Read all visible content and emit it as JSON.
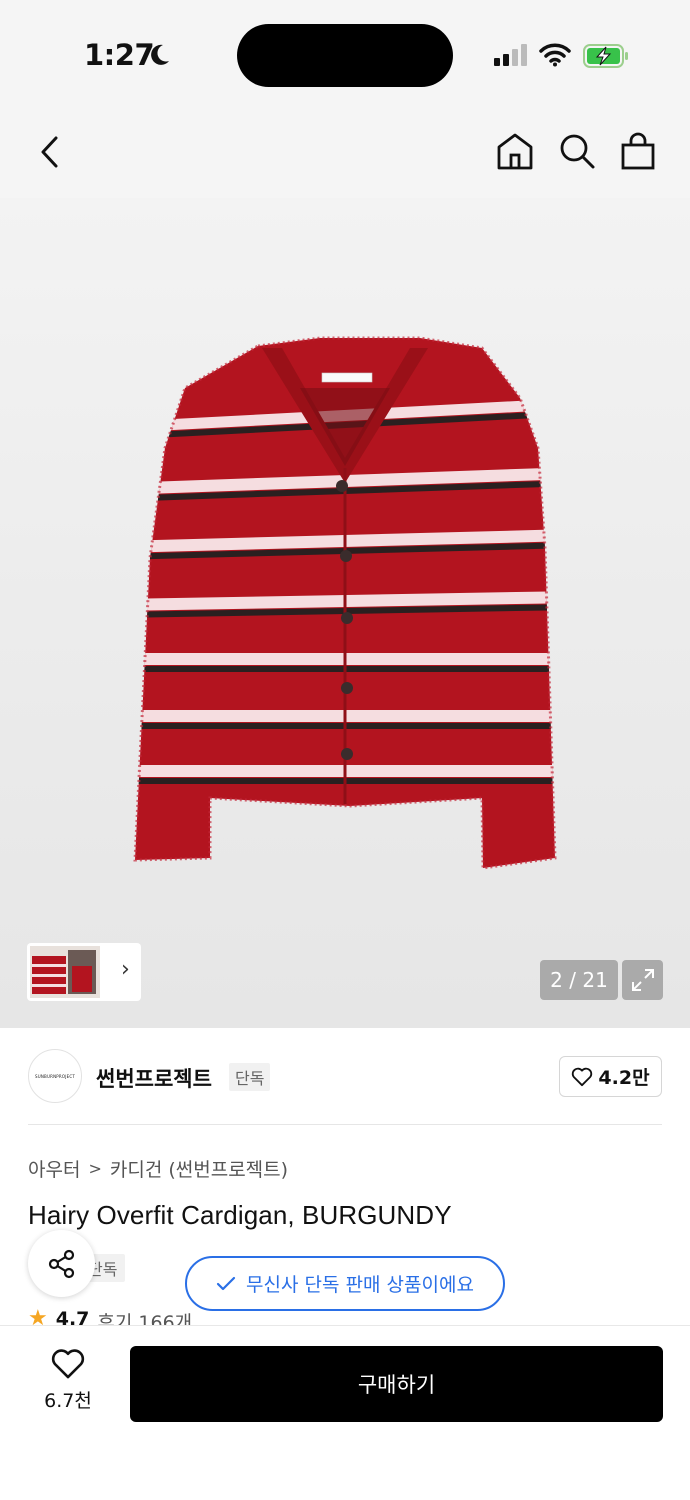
{
  "status_bar": {
    "time": "1:27",
    "icons": [
      "moon-icon",
      "cellular-signal-icon",
      "wifi-icon",
      "battery-charging-icon"
    ]
  },
  "nav": {
    "icons": [
      "back-chevron-icon",
      "home-icon",
      "search-icon",
      "shopping-bag-icon"
    ]
  },
  "gallery": {
    "counter": "2 / 21",
    "thumbnail_arrow": "›",
    "icons": [
      "expand-icon"
    ]
  },
  "brand": {
    "logo_text": "SUNBURNPROJECT",
    "name": "썬번프로젝트",
    "tag": "단독",
    "likes": "4.2만"
  },
  "breadcrumb": {
    "category": "아우터",
    "separator": ">",
    "subcategory": "카디건 (썬번프로젝트)"
  },
  "product": {
    "title": "Hairy Overfit Cardigan, BURGUNDY",
    "exclusive_tag": "단독"
  },
  "toast": {
    "message": "무신사 단독 판매 상품이에요"
  },
  "rating": {
    "score": "4.7",
    "reviews": "후기 166개"
  },
  "bottom_bar": {
    "wish_count": "6.7천",
    "buy_label": "구매하기"
  },
  "colors": {
    "accent_blue": "#2a6fe6",
    "star": "#f5a623",
    "sweater_red": "#b3141f",
    "buy_button": "#000000"
  }
}
